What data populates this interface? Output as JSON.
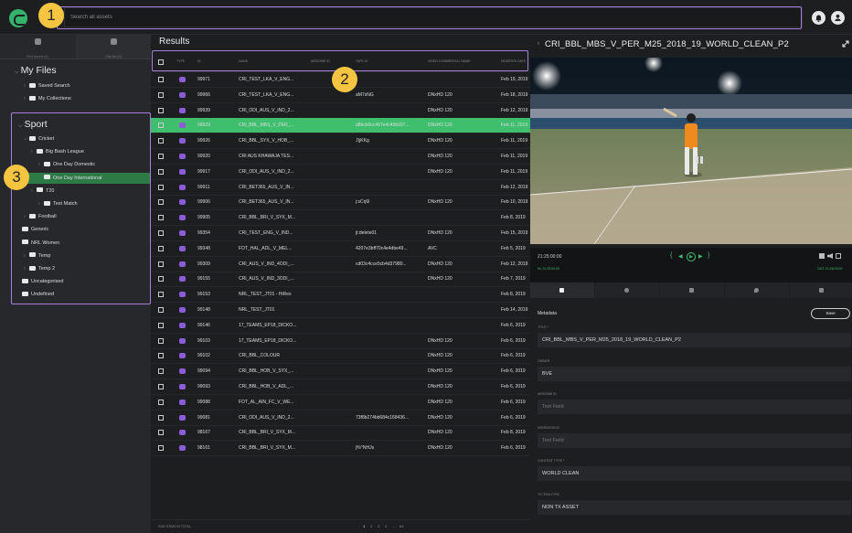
{
  "search": {
    "placeholder": "Search all assets"
  },
  "annotations": [
    "1",
    "2",
    "3"
  ],
  "sidebar": {
    "tabs": [
      {
        "label": "Find Assets (0)"
      },
      {
        "label": "Clip Bin (0)"
      }
    ],
    "my_files_title": "My Files",
    "my_files_items": [
      "Saved Search",
      "My Collections"
    ],
    "sport_title": "Sport",
    "sport_items": [
      {
        "label": "Cricket",
        "chev": "⌵"
      },
      {
        "label": "Big Bash League",
        "chev": "›"
      },
      {
        "label": "One Day Domestic",
        "chev": "›"
      },
      {
        "label": "One Day International",
        "chev": ""
      },
      {
        "label": "T20",
        "chev": "›"
      },
      {
        "label": "Test Match",
        "chev": "›"
      },
      {
        "label": "Football",
        "chev": "›"
      },
      {
        "label": "Generic",
        "chev": ""
      },
      {
        "label": "NRL Women",
        "chev": ""
      },
      {
        "label": "Temp",
        "chev": "›"
      },
      {
        "label": "Temp 2",
        "chev": "›"
      },
      {
        "label": "Uncategorised",
        "chev": ""
      },
      {
        "label": "Undefined",
        "chev": ""
      }
    ]
  },
  "results": {
    "title": "Results",
    "columns": [
      "TYPE",
      "ID",
      "NAME",
      "AIRDOME ID",
      "TAPE ID",
      "VIDEO COMMERCIAL NAME",
      "MODIFIED DATE"
    ],
    "rows": [
      {
        "id": "99971",
        "name": "CRI_TEST_LKA_V_ENG...",
        "tape": "",
        "vcn": "",
        "date": "Feb 19, 2019"
      },
      {
        "id": "99966",
        "name": "CRI_TEST_LKA_V_ENG...",
        "tape": "aM7sNG",
        "vcn": "DNxHD 120",
        "date": "Feb 18, 2019"
      },
      {
        "id": "99939",
        "name": "CRI_ODI_AUS_V_IND_2...",
        "tape": "",
        "vcn": "DNxHD 120",
        "date": "Feb 12, 2019"
      },
      {
        "id": "99929",
        "name": "CRI_BBL_MBS_V_PER_...",
        "tape": "d8bcb0cc497e4c45b937...",
        "vcn": "DNxHD 120",
        "date": "Feb 11, 2019"
      },
      {
        "id": "99926",
        "name": "CRI_BBL_SYX_V_HOB_...",
        "tape": "J)jKKg",
        "vcn": "DNxHD 120",
        "date": "Feb 11, 2019"
      },
      {
        "id": "99920",
        "name": "CRI AUS KHAWAJA TES...",
        "tape": "",
        "vcn": "DNxHD 120",
        "date": "Feb 11, 2019"
      },
      {
        "id": "99917",
        "name": "CRI_ODI_AUS_V_IND_2...",
        "tape": "",
        "vcn": "DNxHD 120",
        "date": "Feb 11, 2019"
      },
      {
        "id": "99911",
        "name": "CRI_BET365_AUS_V_IN...",
        "tape": "",
        "vcn": "",
        "date": "Feb 12, 2019"
      },
      {
        "id": "99906",
        "name": "CRI_BET365_AUS_V_IN...",
        "tape": "j:sCrj6l",
        "vcn": "DNxHD 120",
        "date": "Feb 10, 2019"
      },
      {
        "id": "99905",
        "name": "CRI_BBL_BRI_V_SYX_M...",
        "tape": "",
        "vcn": "",
        "date": "Feb 8, 2019"
      },
      {
        "id": "99354",
        "name": "CRI_TEST_ENG_V_IND...",
        "tape": "jt:delete01",
        "vcn": "DNxHD 120",
        "date": "Feb 15, 2019"
      },
      {
        "id": "99348",
        "name": "FOT_HAL_ADL_V_MEL...",
        "tape": "4207e3bff70c4e4dbe49...",
        "vcn": "AVC",
        "date": "Feb 5, 2019"
      },
      {
        "id": "99309",
        "name": "CRI_AUS_V_IND_4ODI_...",
        "tape": "cd03c4cce5cb4d37980...",
        "vcn": "DNxHD 120",
        "date": "Feb 12, 2019"
      },
      {
        "id": "99155",
        "name": "CRI_AUS_V_IND_3ODI_...",
        "tape": "",
        "vcn": "DNxHD 120",
        "date": "Feb 7, 2019"
      },
      {
        "id": "99153",
        "name": "NRL_TEST_JT01 - HiRes",
        "tape": "",
        "vcn": "",
        "date": "Feb 8, 2019"
      },
      {
        "id": "99148",
        "name": "NRL_TEST_JT01",
        "tape": "",
        "vcn": "",
        "date": "Feb 14, 2019"
      },
      {
        "id": "99146",
        "name": "17_TEAMS_EP18_DICKO...",
        "tape": "",
        "vcn": "",
        "date": "Feb 6, 2019"
      },
      {
        "id": "99103",
        "name": "17_TEAMS_EP18_DICKO...",
        "tape": "",
        "vcn": "DNxHD 120",
        "date": "Feb 6, 2019"
      },
      {
        "id": "99102",
        "name": "CRI_BBL_COLOUR",
        "tape": "",
        "vcn": "DNxHD 120",
        "date": "Feb 6, 2019"
      },
      {
        "id": "99094",
        "name": "CRI_BBL_HOB_V_SYX_...",
        "tape": "",
        "vcn": "DNxHD 120",
        "date": "Feb 6, 2019"
      },
      {
        "id": "99093",
        "name": "CRI_BBL_HOB_V_ADL_...",
        "tape": "",
        "vcn": "DNxHD 120",
        "date": "Feb 6, 2019"
      },
      {
        "id": "99088",
        "name": "FOT_AL_AIN_FC_V_WE...",
        "tape": "",
        "vcn": "DNxHD 120",
        "date": "Feb 6, 2019"
      },
      {
        "id": "99081",
        "name": "CRI_ODI_AUS_V_IND_2...",
        "tape": "73f8b274bb684c168436...",
        "vcn": "DNxHD 120",
        "date": "Feb 6, 2019"
      },
      {
        "id": "98167",
        "name": "CRI_BBL_BRI_V_SYX_M...",
        "tape": "",
        "vcn": "DNxHD 120",
        "date": "Feb 8, 2019"
      },
      {
        "id": "98161",
        "name": "CRI_BBL_BRI_V_SYX_M...",
        "tape": "j%^NHJs",
        "vcn": "DNxHD 120",
        "date": "Feb 6, 2019"
      }
    ],
    "selected_index": 3,
    "footer_total": "9182 ITEMS IN TOTAL",
    "pagination": [
      "1",
      "2",
      "3",
      "4",
      "...",
      "64"
    ]
  },
  "panel": {
    "title": "CRI_BBL_MBS_V_PER_M25_2018_19_WORLD_CLEAN_P2",
    "timecode": "21:25:00:00",
    "in_point": "IN: 21:25:00:00",
    "out_point": "OUT: 21:26:00:00",
    "metadata_title": "Metadata",
    "save_label": "Save",
    "fields": [
      {
        "label": "TITLE *",
        "value": "CRI_BBL_MBS_V_PER_M25_2018_19_WORLD_CLEAN_P2",
        "ph": false
      },
      {
        "label": "OWNER",
        "value": "BVE",
        "ph": false
      },
      {
        "label": "AIRDOME ID",
        "value": "Text Field",
        "ph": true
      },
      {
        "label": "MIGRATION ID",
        "value": "Text Field",
        "ph": true
      },
      {
        "label": "CONTENT TYPE *",
        "value": "WORLD CLEAN",
        "ph": false
      },
      {
        "label": "TX ITEM TYPE",
        "value": "NON TX ASSET",
        "ph": false
      }
    ]
  },
  "colors": {
    "accent": "#3fbf6e",
    "highlight": "#a77fe0",
    "badge": "#f5c542",
    "type_icon": "#8a5cd8"
  }
}
